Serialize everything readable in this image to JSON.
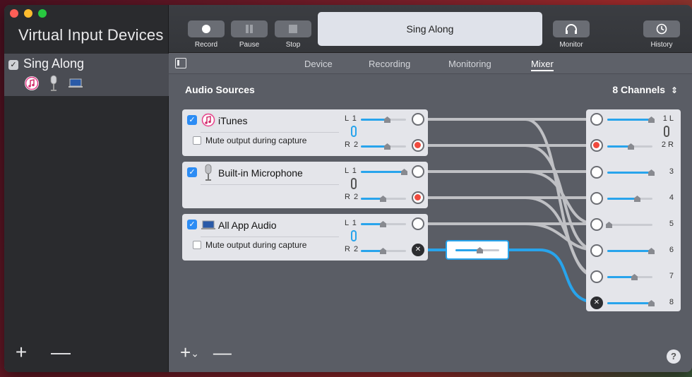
{
  "sidebar": {
    "title": "Virtual Input Devices",
    "items": [
      {
        "label": "Sing Along",
        "checked": true,
        "icons": [
          "itunes-icon",
          "microphone-icon",
          "laptop-icon"
        ]
      }
    ],
    "add_label": "+",
    "remove_label": "—"
  },
  "toolbar": {
    "record_label": "Record",
    "pause_label": "Pause",
    "stop_label": "Stop",
    "now_playing": "Sing Along",
    "monitor_label": "Monitor",
    "history_label": "History"
  },
  "tabs": [
    {
      "label": "Device",
      "active": false
    },
    {
      "label": "Recording",
      "active": false
    },
    {
      "label": "Monitoring",
      "active": false
    },
    {
      "label": "Mixer",
      "active": true
    }
  ],
  "mixer": {
    "section_title": "Audio Sources",
    "channels_label": "8 Channels",
    "sources": [
      {
        "name": "iTunes",
        "checked": true,
        "mute_label": "Mute output during capture",
        "left": "L 1",
        "right": "R 2"
      },
      {
        "name": "Built-in Microphone",
        "checked": true,
        "left": "L 1",
        "right": "R 2"
      },
      {
        "name": "All App Audio",
        "checked": true,
        "mute_label": "Mute output during capture",
        "left": "L 1",
        "right": "R 2"
      }
    ],
    "outputs": [
      "1 L",
      "2 R",
      "3",
      "4",
      "5",
      "6",
      "7",
      "8"
    ]
  },
  "footer": {
    "add_label": "+",
    "add_chevron": "⌄",
    "remove_label": "—",
    "help_label": "?"
  },
  "colors": {
    "accent": "#28a4ec",
    "checkbox": "#2c8cf4",
    "port_active": "#f04a3e"
  }
}
